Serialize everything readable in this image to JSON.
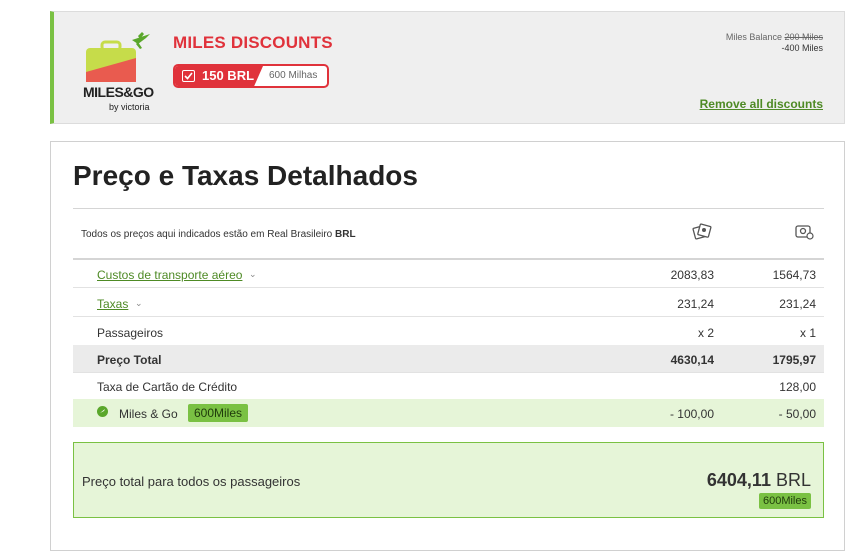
{
  "banner": {
    "logo_text": "MILES&GO",
    "logo_sub": "by victoria",
    "title": "MILES DISCOUNTS",
    "pill_amount": "150 BRL",
    "pill_miles": "600 Milhas",
    "balance_label": "Miles Balance",
    "balance_old": "200 Miles",
    "balance_change": "-400 Miles",
    "remove_link": "Remove all discounts"
  },
  "card": {
    "title": "Preço e Taxas Detalhados",
    "note_prefix": "Todos os preços aqui indicados estão em Real Brasileiro",
    "note_currency": "BRL",
    "column_icons": [
      "passenger-group-icon",
      "passenger-single-icon"
    ]
  },
  "rows": {
    "transport": {
      "label": "Custos de transporte aéreo",
      "v1": "2083,83",
      "v2": "1564,73"
    },
    "taxes": {
      "label": "Taxas",
      "v1": "231,24",
      "v2": "231,24"
    },
    "passengers": {
      "label": "Passageiros",
      "v1": "x 2",
      "v2": "x 1"
    },
    "total": {
      "label": "Preço Total",
      "v1": "4630,14",
      "v2": "1795,97"
    },
    "card_fee": {
      "label": "Taxa de Cartão de Crédito",
      "v1": "",
      "v2": "128,00"
    },
    "miles": {
      "label": "Miles & Go",
      "badge": "600Miles",
      "v1": "- 100,00",
      "v2": "- 50,00"
    }
  },
  "summary": {
    "label": "Preço total para todos os passageiros",
    "amount": "6404,11",
    "currency": "BRL",
    "badge": "600Miles"
  },
  "colors": {
    "brand_red": "#e0323b",
    "brand_green": "#7ac143",
    "link_green": "#4e8a25",
    "highlight_green": "#e6f5d8"
  }
}
